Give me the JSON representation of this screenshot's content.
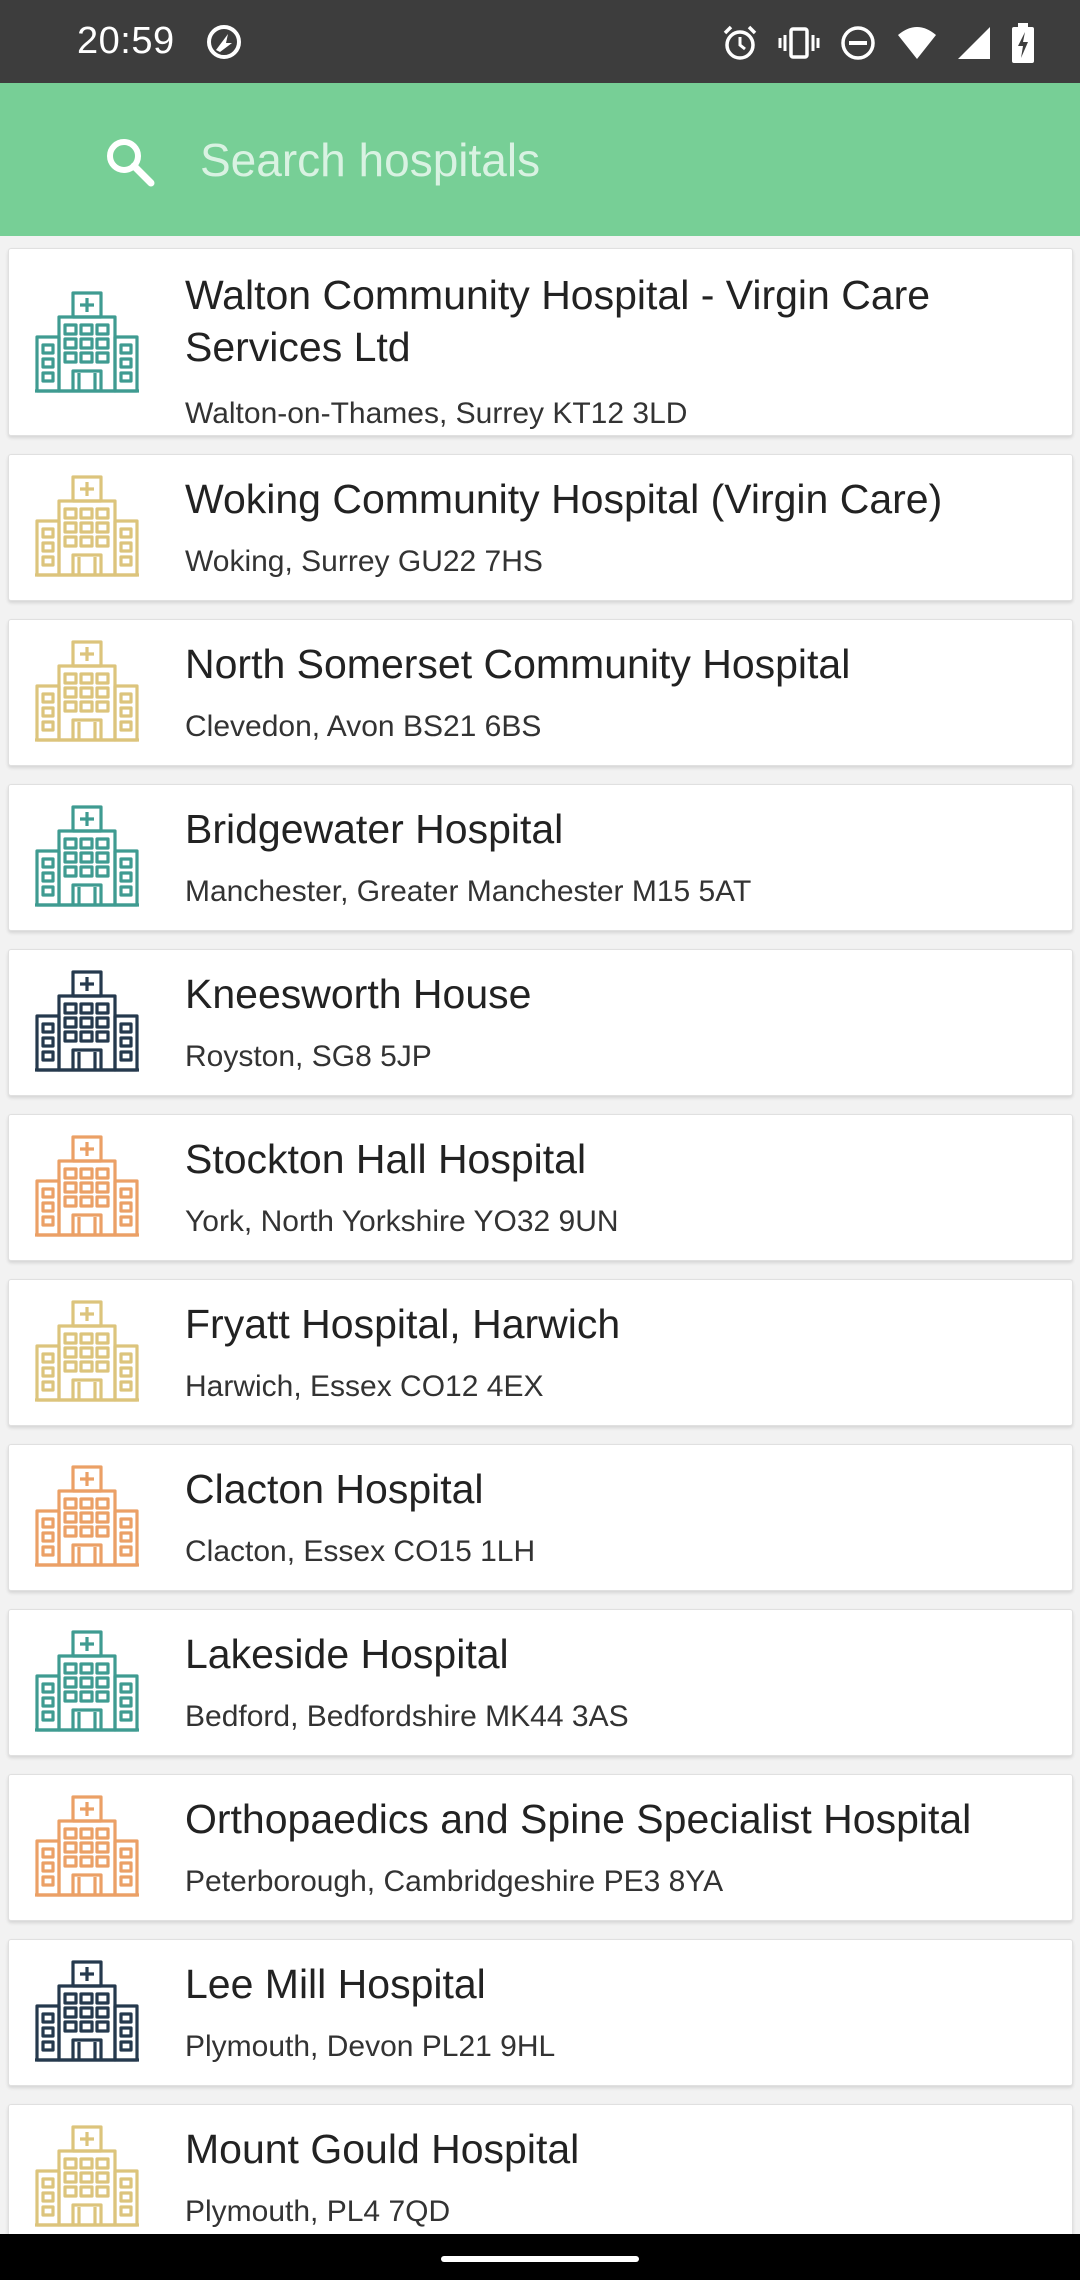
{
  "status_bar": {
    "time": "20:59",
    "left_icons": [
      "data-saver-icon"
    ],
    "right_icons": [
      "alarm-icon",
      "vibrate-icon",
      "do-not-disturb-icon",
      "wifi-icon",
      "cellular-signal-icon",
      "battery-charging-icon"
    ]
  },
  "search": {
    "placeholder": "Search hospitals",
    "value": "",
    "background_color": "#77cf96"
  },
  "icon_colors": {
    "teal": "#3f9b91",
    "yellow": "#dcc47c",
    "navy": "#25394d",
    "orange": "#eba066"
  },
  "hospitals": [
    {
      "title": "Walton Community Hospital - Virgin Care Services Ltd",
      "address": "Walton-on-Thames, Surrey KT12 3LD",
      "icon_color": "teal"
    },
    {
      "title": "Woking Community Hospital (Virgin Care)",
      "address": "Woking, Surrey GU22 7HS",
      "icon_color": "yellow"
    },
    {
      "title": "North Somerset Community Hospital",
      "address": "Clevedon, Avon BS21 6BS",
      "icon_color": "yellow"
    },
    {
      "title": "Bridgewater Hospital",
      "address": "Manchester, Greater Manchester M15 5AT",
      "icon_color": "teal"
    },
    {
      "title": "Kneesworth House",
      "address": "Royston,  SG8 5JP",
      "icon_color": "navy"
    },
    {
      "title": "Stockton Hall Hospital",
      "address": "York, North Yorkshire YO32 9UN",
      "icon_color": "orange"
    },
    {
      "title": "Fryatt Hospital, Harwich",
      "address": "Harwich, Essex CO12 4EX",
      "icon_color": "yellow"
    },
    {
      "title": "Clacton Hospital",
      "address": "Clacton, Essex CO15 1LH",
      "icon_color": "orange"
    },
    {
      "title": "Lakeside Hospital",
      "address": "Bedford, Bedfordshire MK44 3AS",
      "icon_color": "teal"
    },
    {
      "title": "Orthopaedics and Spine Specialist Hospital",
      "address": "Peterborough, Cambridgeshire PE3 8YA",
      "icon_color": "orange"
    },
    {
      "title": "Lee Mill Hospital",
      "address": "Plymouth, Devon PL21 9HL",
      "icon_color": "navy"
    },
    {
      "title": "Mount Gould Hospital",
      "address": "Plymouth,  PL4 7QD",
      "icon_color": "yellow"
    }
  ]
}
